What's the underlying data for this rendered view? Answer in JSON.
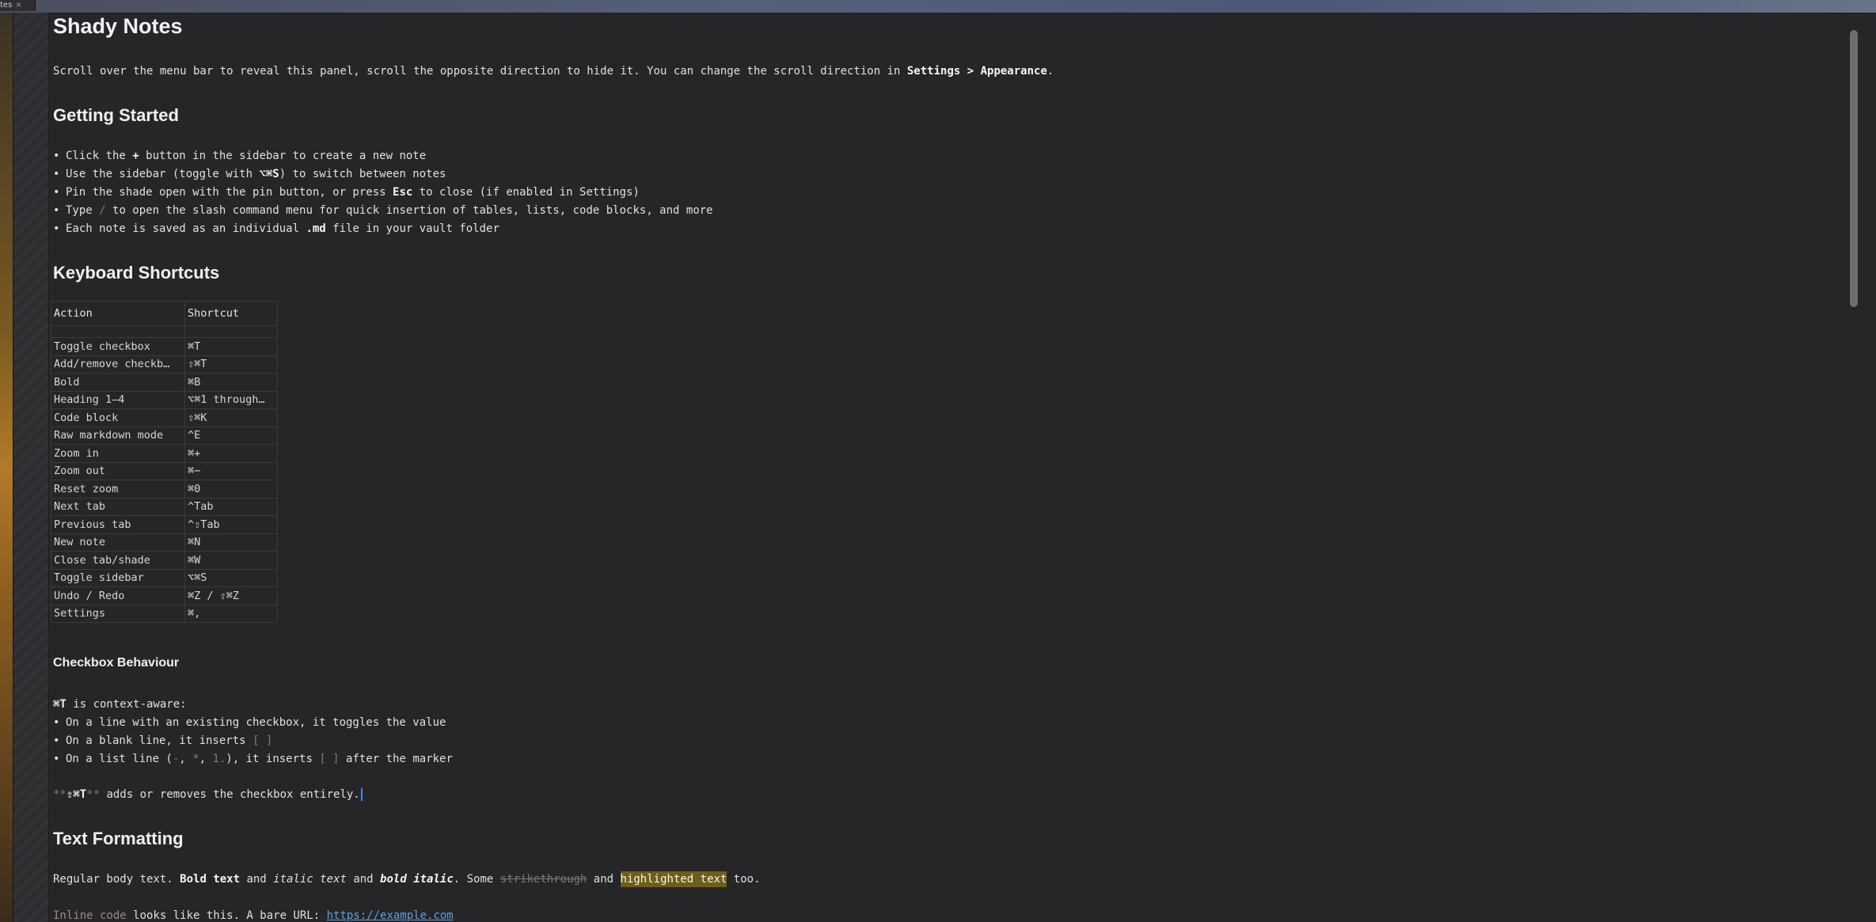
{
  "tab": {
    "label": "tes",
    "close": "×"
  },
  "title": "Shady Notes",
  "intro": {
    "text_before": "Scroll over the menu bar to reveal this panel, scroll the opposite direction to hide it. You can change the scroll direction in ",
    "settings_path": "Settings > Appearance",
    "text_after": "."
  },
  "getting_started": {
    "heading": "Getting Started",
    "items": [
      {
        "a": "Click the ",
        "b": "+",
        "c": " button in the sidebar to create a new note"
      },
      {
        "a": "Use the sidebar (toggle with ",
        "b": "⌥⌘S",
        "c": ") to switch between notes"
      },
      {
        "a": "Pin the shade open with the pin button, or press ",
        "b": "Esc",
        "c": " to close (if enabled in Settings)"
      },
      {
        "a": "Type ",
        "b": "/",
        "c": " to open the slash command menu for quick insertion of tables, lists, code blocks, and more"
      },
      {
        "a": "Each note is saved as an individual ",
        "b": ".md",
        "c": " file in your vault folder"
      }
    ]
  },
  "shortcuts": {
    "heading": "Keyboard Shortcuts",
    "col_action": "Action",
    "col_shortcut": "Shortcut",
    "rows": [
      {
        "action": "Toggle checkbox",
        "shortcut": "⌘T"
      },
      {
        "action": "Add/remove checkb…",
        "shortcut": "⇧⌘T"
      },
      {
        "action": "Bold",
        "shortcut": "⌘B"
      },
      {
        "action": "Heading 1–4",
        "shortcut": "⌥⌘1 through…"
      },
      {
        "action": "Code block",
        "shortcut": "⇧⌘K"
      },
      {
        "action": "Raw markdown mode",
        "shortcut": "^E"
      },
      {
        "action": "Zoom in",
        "shortcut": "⌘+"
      },
      {
        "action": "Zoom out",
        "shortcut": "⌘−"
      },
      {
        "action": "Reset zoom",
        "shortcut": "⌘0"
      },
      {
        "action": "Next tab",
        "shortcut": "^Tab"
      },
      {
        "action": "Previous tab",
        "shortcut": "^⇧Tab"
      },
      {
        "action": "New note",
        "shortcut": "⌘N"
      },
      {
        "action": "Close tab/shade",
        "shortcut": "⌘W"
      },
      {
        "action": "Toggle sidebar",
        "shortcut": "⌥⌘S"
      },
      {
        "action": "Undo / Redo",
        "shortcut": "⌘Z / ⇧⌘Z"
      },
      {
        "action": "Settings",
        "shortcut": "⌘,"
      }
    ]
  },
  "checkbox": {
    "heading": "Checkbox Behaviour",
    "lead_key": "⌘T",
    "lead_text": " is context-aware:",
    "items": [
      {
        "a": "On a line with an existing checkbox, it toggles the value"
      },
      {
        "a": "On a blank line, it inserts ",
        "code": "[ ]"
      },
      {
        "a": "On a list line (",
        "m1": "-",
        "sep1": ", ",
        "m2": "*",
        "sep2": ", ",
        "m3": "1.",
        "b": "), it inserts ",
        "code": "[ ]",
        "c": " after the marker"
      }
    ],
    "raw_marks": "**",
    "raw_key": "⇧⌘T",
    "raw_text": " adds or removes the checkbox entirely."
  },
  "formatting": {
    "heading": "Text Formatting",
    "regular": "Regular body text. ",
    "bold": "Bold text",
    "and1": " and ",
    "italic": "italic text",
    "and2": " and ",
    "bold_italic": "bold italic",
    "some": ". Some ",
    "strike": "strikethrough",
    "and3": " and ",
    "highlight": "highlighted text",
    "too": " too.",
    "inline_code": "Inline code",
    "looks": " looks like this. A bare URL: ",
    "url": "https://example.com"
  }
}
